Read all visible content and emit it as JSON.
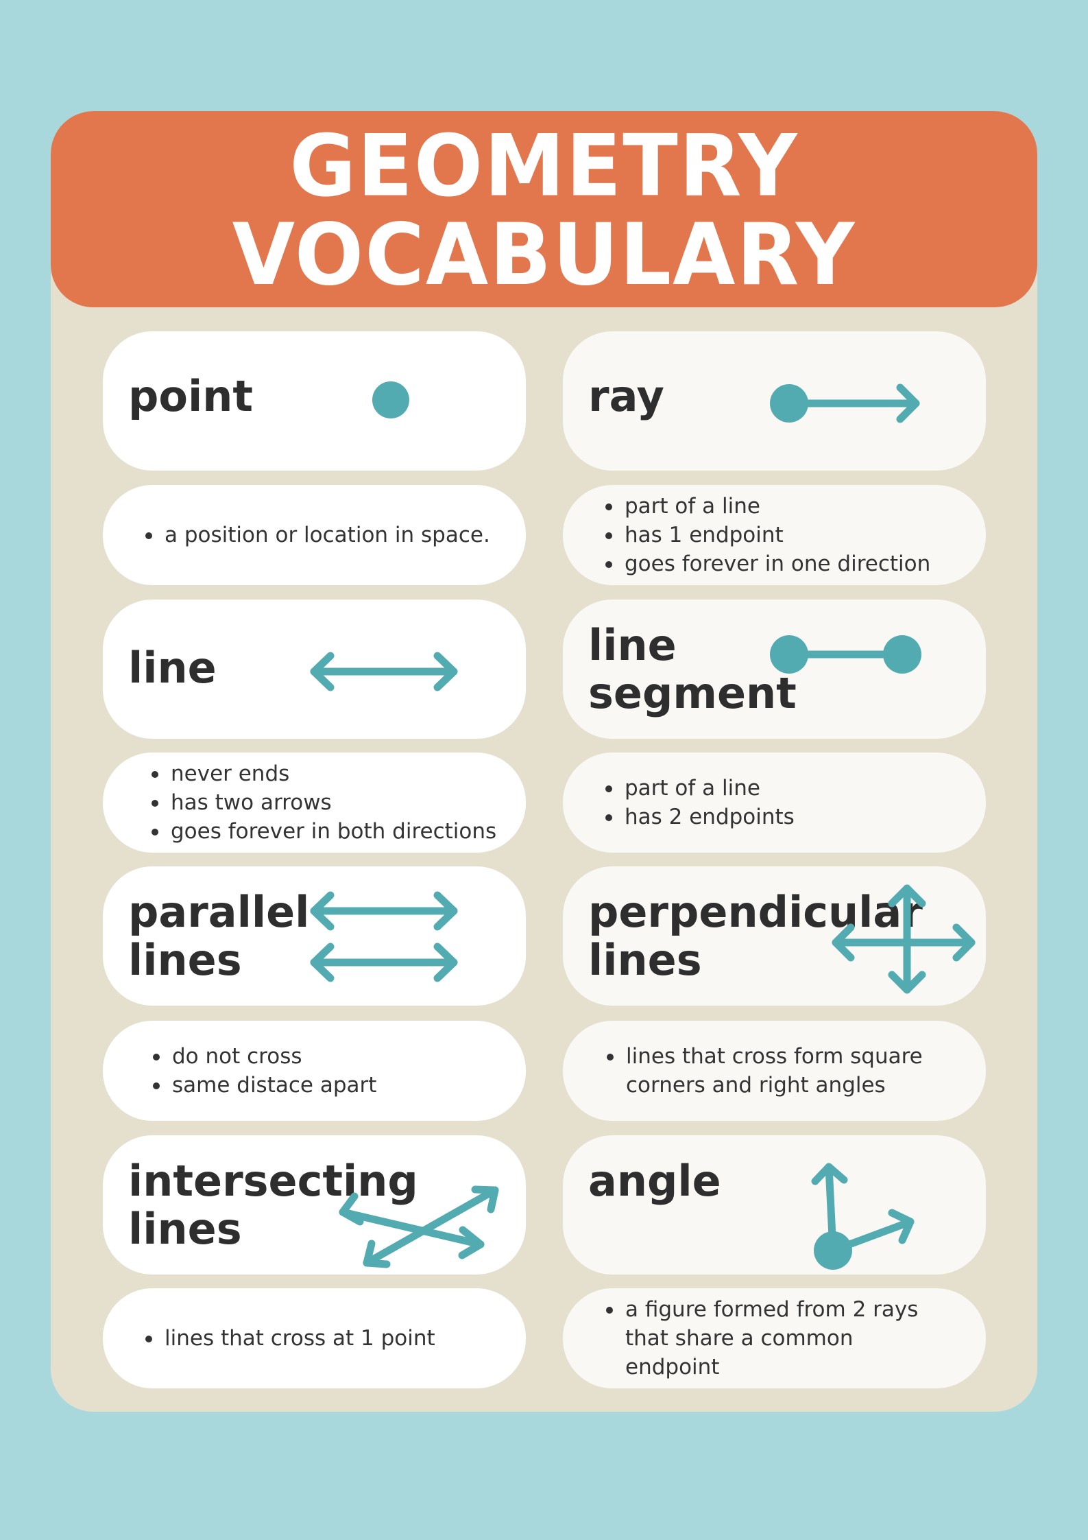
{
  "title": {
    "line1": "GEOMETRY",
    "line2": "VOCABULARY"
  },
  "accent_color": "#53abb2",
  "header_color": "#e2774e",
  "background_color": "#a8d8dc",
  "cards": {
    "point": {
      "term": "point",
      "icon": "point-icon",
      "bullets": [
        "a position or location in space."
      ]
    },
    "ray": {
      "term": "ray",
      "icon": "ray-icon",
      "bullets": [
        "part of a line",
        "has 1 endpoint",
        "goes forever in one direction"
      ]
    },
    "line": {
      "term": "line",
      "icon": "line-icon",
      "bullets": [
        "never ends",
        "has two arrows",
        "goes forever in both directions"
      ]
    },
    "segment": {
      "term1": "line",
      "term2": "segment",
      "icon": "line-segment-icon",
      "bullets": [
        "part of a line",
        "has 2 endpoints"
      ]
    },
    "parallel": {
      "term1": "parallel",
      "term2": "lines",
      "icon": "parallel-lines-icon",
      "bullets": [
        "do not cross",
        "same distace apart"
      ]
    },
    "perpendicular": {
      "term1": "perpendicular",
      "term2": "lines",
      "icon": "perpendicular-lines-icon",
      "bullets": [
        "lines that cross form square corners and right angles"
      ]
    },
    "intersecting": {
      "term1": "intersecting",
      "term2": "lines",
      "icon": "intersecting-lines-icon",
      "bullets": [
        "lines that cross at 1 point"
      ]
    },
    "angle": {
      "term": "angle",
      "icon": "angle-icon",
      "bullets": [
        "a figure formed from 2 rays that share a common endpoint"
      ]
    }
  }
}
